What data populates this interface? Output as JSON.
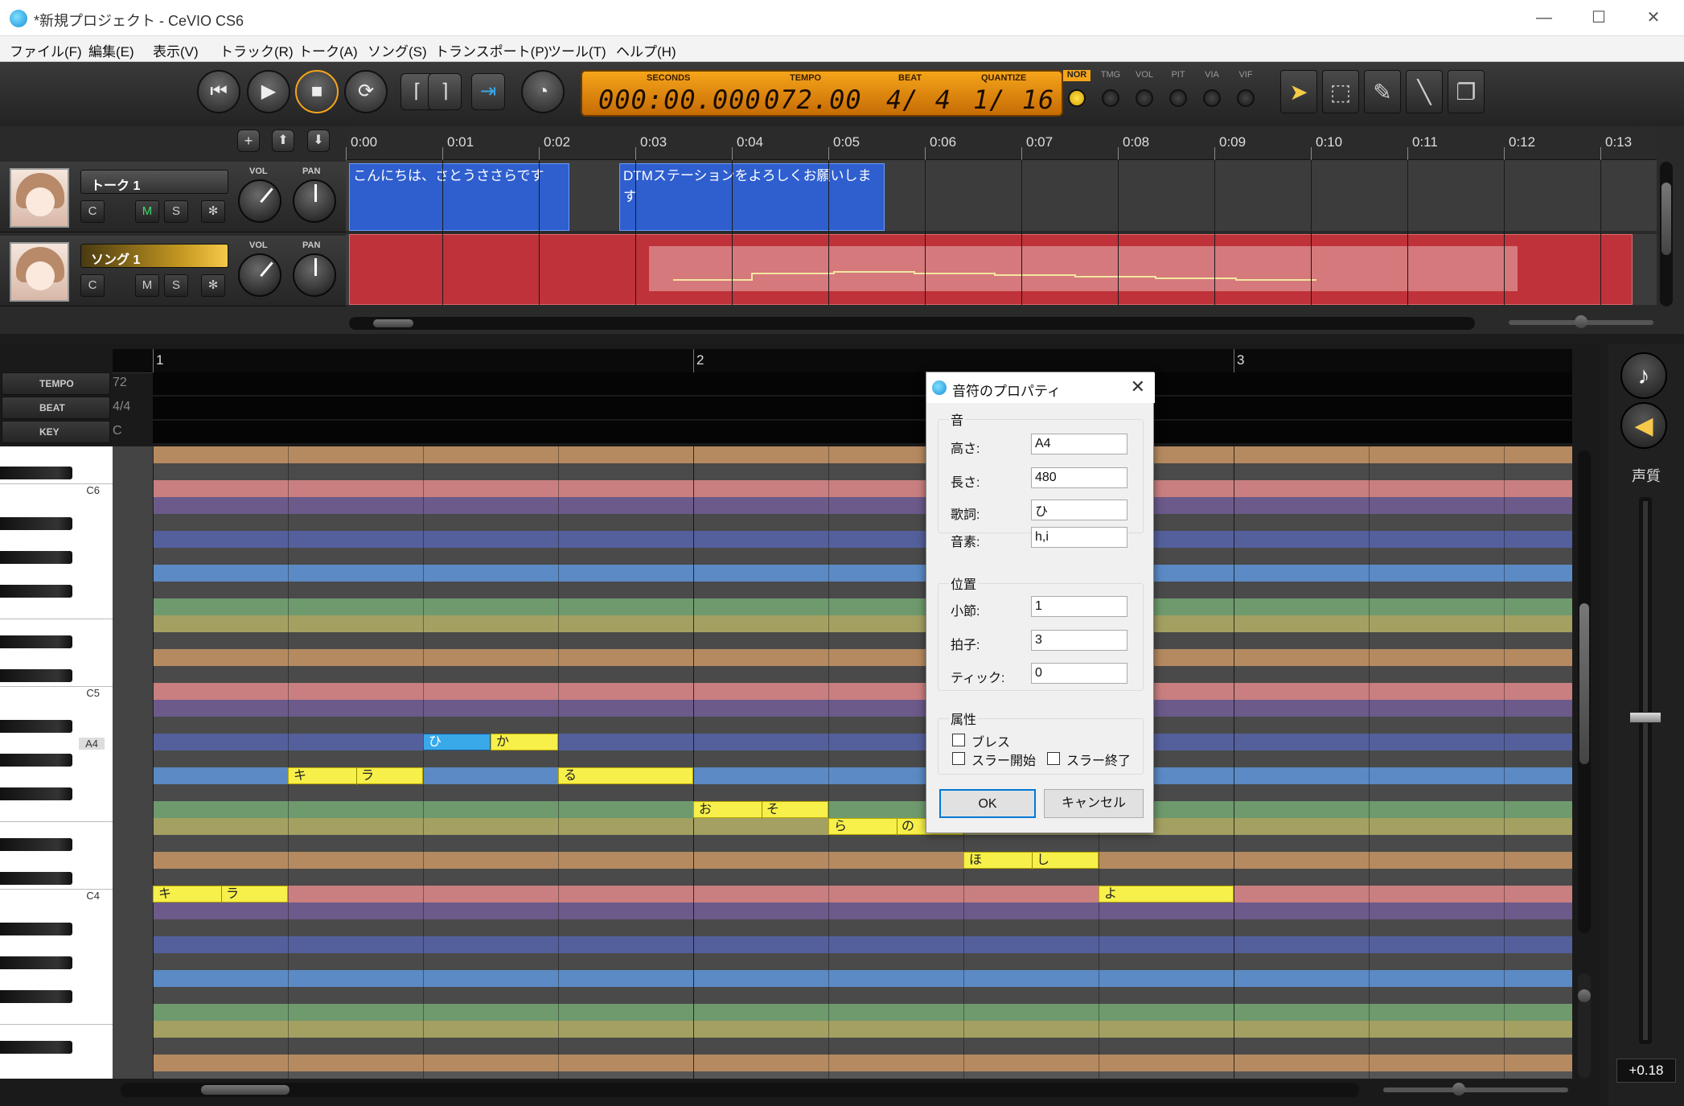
{
  "window": {
    "title": "*新規プロジェクト - CeVIO CS6",
    "minimize": "—",
    "maximize": "☐",
    "close": "✕"
  },
  "menu": [
    "ファイル(F)",
    "編集(E)",
    "表示(V)",
    "トラック(R)",
    "トーク(A)",
    "ソング(S)",
    "トランスポート(P)",
    "ツール(T)",
    "ヘルプ(H)"
  ],
  "transport": {
    "seconds_label": "SECONDS",
    "seconds": "000:00.000",
    "tempo_label": "TEMPO",
    "tempo": "072.00",
    "beat_label": "BEAT",
    "beat": "4/ 4",
    "quantize_label": "QUANTIZE",
    "quantize": "1/ 16"
  },
  "modes": [
    "NOR",
    "TMG",
    "VOL",
    "PIT",
    "VIA",
    "VIF"
  ],
  "tracks": [
    {
      "name": "トーク 1",
      "c": "C",
      "m": "M",
      "s": "S",
      "fx": "✻",
      "vol_label": "VOL",
      "pan_label": "PAN"
    },
    {
      "name": "ソング 1",
      "c": "C",
      "m": "M",
      "s": "S",
      "fx": "✻",
      "vol_label": "VOL",
      "pan_label": "PAN"
    }
  ],
  "timeline": [
    "0:00",
    "0:01",
    "0:02",
    "0:03",
    "0:04",
    "0:05",
    "0:06",
    "0:07",
    "0:08",
    "0:09",
    "0:10",
    "0:11",
    "0:12",
    "0:13"
  ],
  "talk_clips": [
    "こんにちは、さとうささらです",
    "DTMステーションをよろしくお願いしま す"
  ],
  "piano": {
    "bars": [
      "1",
      "2",
      "3"
    ],
    "tempo_label": "TEMPO",
    "tempo_value": "72",
    "beat_label": "BEAT",
    "beat_value": "4/4",
    "key_label": "KEY",
    "key_value": "C",
    "key_labels": {
      "c6": "C6",
      "c5": "C5",
      "a4": "A4",
      "c4": "C4"
    }
  },
  "notes": [
    {
      "lyric": "キ",
      "lyric2": "ラ",
      "row": "C4",
      "beat": 0
    },
    {
      "lyric": "キ",
      "lyric2": "ラ",
      "row": "G4",
      "beat": 1
    },
    {
      "lyric": "ひ",
      "lyric2": "か",
      "row": "A4",
      "beat": 2
    },
    {
      "lyric": "る",
      "lyric2": "",
      "row": "G4",
      "beat": 3
    },
    {
      "lyric": "お",
      "lyric2": "そ",
      "row": "F4",
      "beat": 4
    },
    {
      "lyric": "ら",
      "lyric2": "の",
      "row": "E4",
      "beat": 5
    },
    {
      "lyric": "ほ",
      "lyric2": "し",
      "row": "D4",
      "beat": 6
    },
    {
      "lyric": "よ",
      "lyric2": "",
      "row": "C4",
      "beat": 7
    }
  ],
  "right_panel": {
    "voice_label": "声質",
    "value": "+0.18"
  },
  "dialog": {
    "title": "音符のプロパティ",
    "group_sound": "音",
    "pitch_label": "高さ:",
    "pitch": "A4",
    "length_label": "長さ:",
    "length": "480",
    "lyric_label": "歌詞:",
    "lyric": "ひ",
    "phoneme_label": "音素:",
    "phoneme": "h,i",
    "group_position": "位置",
    "measure_label": "小節:",
    "measure": "1",
    "beat_label": "拍子:",
    "beat": "3",
    "tick_label": "ティック:",
    "tick": "0",
    "group_attr": "属性",
    "breath": "ブレス",
    "slur_start": "スラー開始",
    "slur_end": "スラー終了",
    "ok": "OK",
    "cancel": "キャンセル"
  },
  "colors": {
    "accent": "#f6a51a",
    "talk_clip": "#2f5fcf",
    "song_clip": "#c0323a",
    "note": "#f7f04a",
    "note_selected": "#3aa9ea"
  }
}
